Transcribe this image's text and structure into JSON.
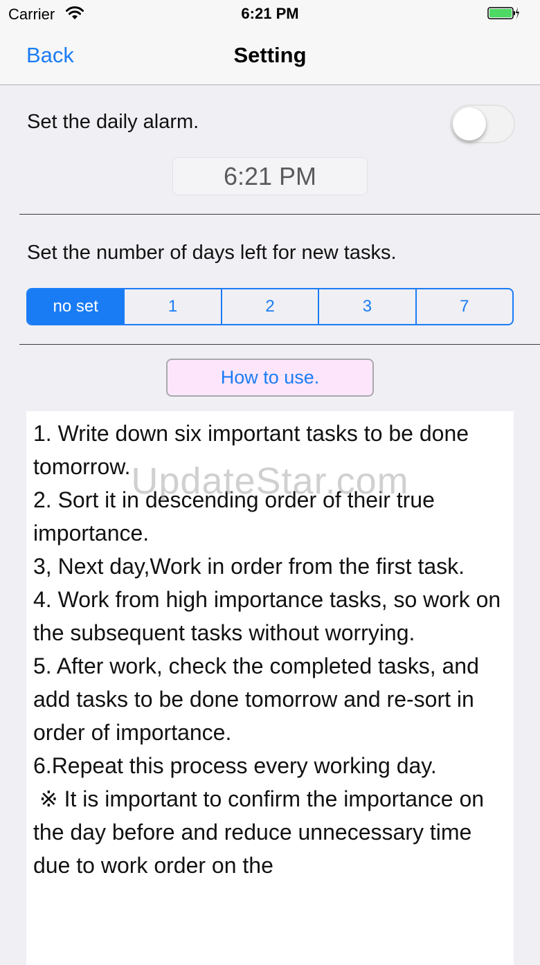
{
  "status_bar": {
    "carrier": "Carrier",
    "time": "6:21 PM",
    "wifi_icon": "wifi-icon",
    "battery_icon": "battery-charging-icon",
    "battery_level": 1.0,
    "battery_color": "#4cd964"
  },
  "nav": {
    "back_label": "Back",
    "title": "Setting"
  },
  "alarm": {
    "label": "Set the daily alarm.",
    "enabled": false,
    "time": "6:21 PM"
  },
  "days_left": {
    "label": "Set the number of days left for new tasks.",
    "options": [
      "no set",
      "1",
      "2",
      "3",
      "7"
    ],
    "selected_index": 0
  },
  "how_to": {
    "button_label": "How to use.",
    "text": "1. Write down six important tasks to be done tomorrow.\n2. Sort it in descending order of their true importance.\n3, Next day,Work in order from the first task.\n4. Work from high importance tasks, so work on the subsequent tasks without worrying.\n5. After work, check the completed tasks, and add tasks to be done tomorrow and re-sort in order of importance.\n6.Repeat this process every working day.\n ※ It is important to confirm the importance on the day before and reduce unnecessary time due to work order on the"
  },
  "watermark": "UpdateStar.com",
  "colors": {
    "accent": "#1a7cf5",
    "button_background": "#fde6fb",
    "background": "#efeff4"
  }
}
